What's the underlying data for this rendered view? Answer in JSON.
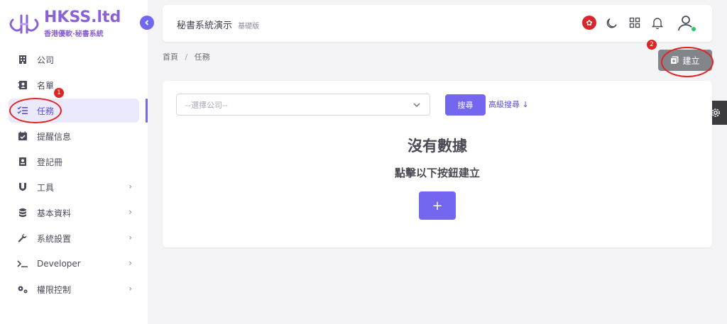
{
  "brand": {
    "title": "HKSS.ltd",
    "subtitle": "香港優軟·秘書系統",
    "color": "#8a63d2",
    "accent": "#7367f0"
  },
  "sidebar": {
    "collapse_icon": "chevron-left-icon",
    "items": [
      {
        "label": "公司",
        "icon": "building-icon",
        "has_children": false
      },
      {
        "label": "名單",
        "icon": "contact-card-icon",
        "has_children": false
      },
      {
        "label": "任務",
        "icon": "checklist-icon",
        "has_children": false,
        "active": true
      },
      {
        "label": "提醒信息",
        "icon": "calendar-check-icon",
        "has_children": false
      },
      {
        "label": "登記冊",
        "icon": "register-book-icon",
        "has_children": false
      },
      {
        "label": "工具",
        "icon": "magnet-icon",
        "has_children": true
      },
      {
        "label": "基本資料",
        "icon": "database-icon",
        "has_children": true
      },
      {
        "label": "系統設置",
        "icon": "wrench-icon",
        "has_children": true
      },
      {
        "label": "Developer",
        "icon": "terminal-icon",
        "has_children": true
      },
      {
        "label": "權限控制",
        "icon": "gears-icon",
        "has_children": true
      }
    ]
  },
  "header": {
    "title": "秘書系統演示",
    "badge": "基礎版",
    "icons": [
      "hk-flag-icon",
      "moon-icon",
      "grid-icon",
      "bell-icon",
      "user-avatar-icon"
    ]
  },
  "breadcrumb": {
    "home": "首頁",
    "separator": "/",
    "current": "任務"
  },
  "actions": {
    "create_label": "建立"
  },
  "filter": {
    "company_placeholder": "--選擇公司--",
    "search_label": "搜尋",
    "advanced_label": "高級搜尋 ↓"
  },
  "empty_state": {
    "title": "沒有數據",
    "subtitle": "點擊以下按鈕建立",
    "add_label": "+"
  },
  "annotations": {
    "badge1": "1",
    "badge2": "2",
    "color": "#e02424"
  }
}
